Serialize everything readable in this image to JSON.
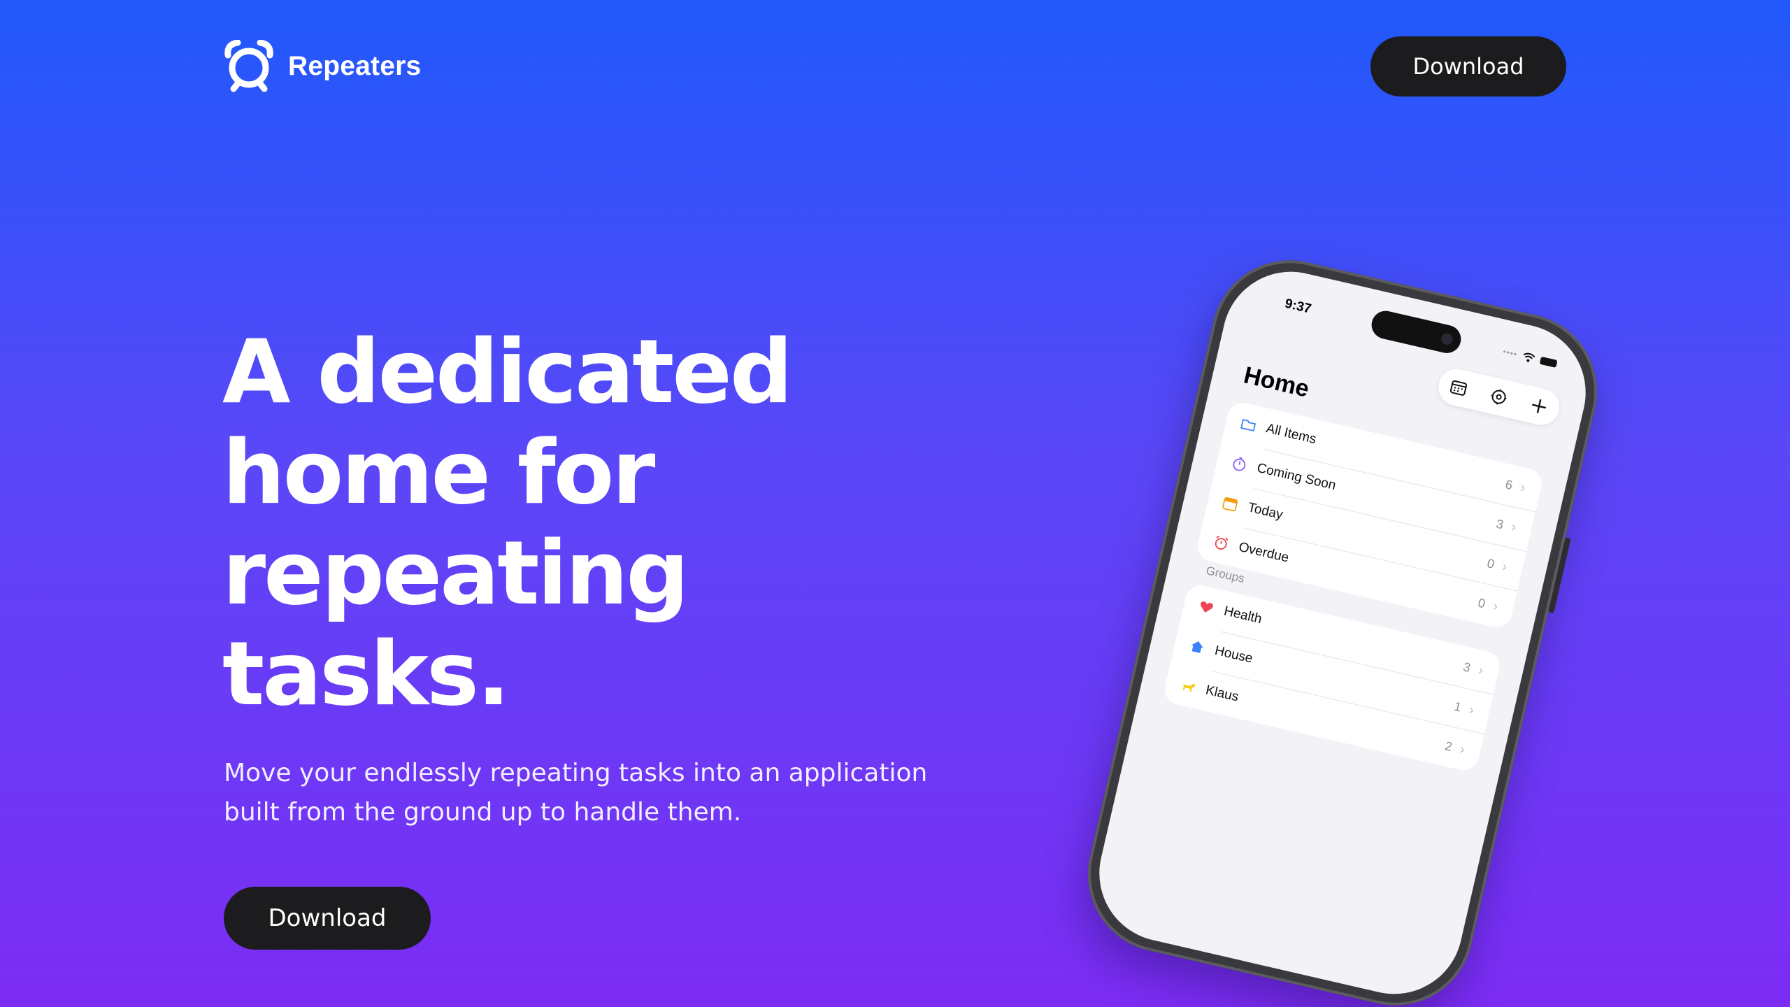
{
  "brand": {
    "name": "Repeaters",
    "logo_icon": "alarm-clock-icon"
  },
  "header": {
    "download_label": "Download"
  },
  "hero": {
    "headline_lines": [
      "A dedicated",
      "home for",
      "repeating",
      "tasks."
    ],
    "subhead": "Move your endlessly repeating tasks into an application built from the ground up to handle them.",
    "download_label": "Download"
  },
  "colors": {
    "gradient_top": "#2059fb",
    "gradient_bottom": "#7d2cf4",
    "button_bg": "#1c1c1e",
    "text": "#ffffff"
  },
  "phone": {
    "status_time": "9:37",
    "title": "Home",
    "toolbar_icons": [
      "calendar-icon",
      "settings-icon",
      "plus-icon"
    ],
    "main_items": [
      {
        "label": "All Items",
        "count": "6",
        "icon": "folder-icon",
        "color": "#3b82f6"
      },
      {
        "label": "Coming Soon",
        "count": "3",
        "icon": "timer-icon",
        "color": "#8b5cf6"
      },
      {
        "label": "Today",
        "count": "0",
        "icon": "calendar-icon",
        "color": "#f59e0b"
      },
      {
        "label": "Overdue",
        "count": "0",
        "icon": "alarm-icon",
        "color": "#ef4444"
      }
    ],
    "groups_label": "Groups",
    "groups": [
      {
        "label": "Health",
        "count": "3",
        "icon": "heart-icon",
        "color": "#ef4456"
      },
      {
        "label": "House",
        "count": "1",
        "icon": "house-icon",
        "color": "#3b82f6"
      },
      {
        "label": "Klaus",
        "count": "2",
        "icon": "dog-icon",
        "color": "#facc15"
      }
    ]
  }
}
